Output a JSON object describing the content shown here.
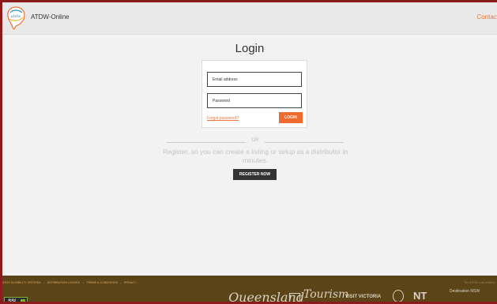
{
  "header": {
    "brand": "ATDW-Online",
    "contact_label": "Contact"
  },
  "login": {
    "title": "Login",
    "email_placeholder": "Email address",
    "password_placeholder": "Password",
    "forgot_label": "Forgot password?",
    "login_label": "LOGIN"
  },
  "register": {
    "or_label": "OR",
    "text": "Register, so you can create a listing or setup as a distributor in minutes.",
    "button_label": "REGISTER NOW"
  },
  "footer": {
    "links": [
      "ATDO ELIGIBILITY CRITERIA",
      "DISTRIBUTION LICENCE",
      "TERMS & CONDITIONS",
      "PRIVACY"
    ],
    "copyright": "The ATDW is an initiative",
    "ssl_label": "SSL",
    "partners": {
      "qld": "Queensland",
      "tourism": "Tourism",
      "vic": "VISIT VICTORIA",
      "nt": "NT",
      "nsw": "Destination NSW"
    }
  },
  "colors": {
    "accent": "#ef6a2f",
    "border": "#8b1c1c",
    "footer": "#5a4418",
    "dark_button": "#333333"
  }
}
